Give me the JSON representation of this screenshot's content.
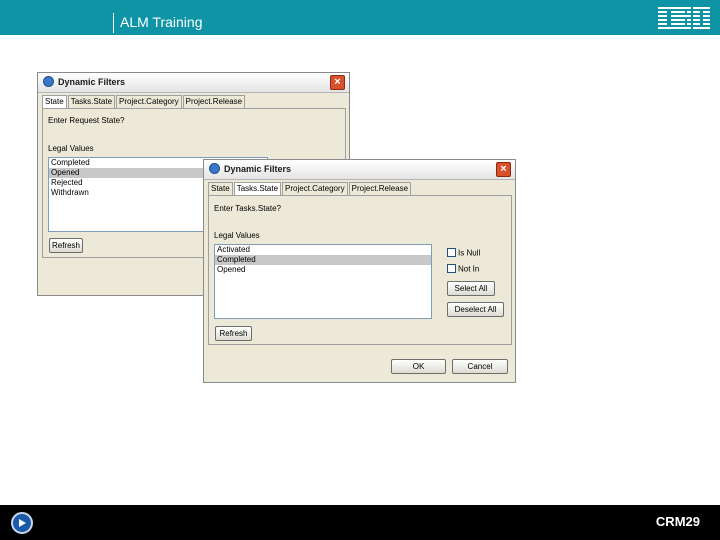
{
  "banner": {
    "title": "ALM Training",
    "logo": "IBM"
  },
  "footer": {
    "code": "CRM29"
  },
  "dialog_back": {
    "title": "Dynamic Filters",
    "tabs": [
      "State",
      "Tasks.State",
      "Project.Category",
      "Project.Release"
    ],
    "active_tab": "State",
    "prompt": "Enter Request State?",
    "legal_values_label": "Legal Values",
    "items": [
      "Completed",
      "Opened",
      "Rejected",
      "Withdrawn"
    ],
    "selected": "Opened",
    "refresh_label": "Refresh"
  },
  "dialog_front": {
    "title": "Dynamic Filters",
    "tabs": [
      "State",
      "Tasks.State",
      "Project.Category",
      "Project.Release"
    ],
    "active_tab": "Tasks.State",
    "prompt": "Enter Tasks.State?",
    "legal_values_label": "Legal Values",
    "items": [
      "Activated",
      "Completed",
      "Opened"
    ],
    "selected": "Completed",
    "is_null_label": "Is Null",
    "not_in_label": "Not In",
    "select_all_label": "Select All",
    "deselect_all_label": "Deselect All",
    "refresh_label": "Refresh",
    "ok_label": "OK",
    "cancel_label": "Cancel"
  }
}
